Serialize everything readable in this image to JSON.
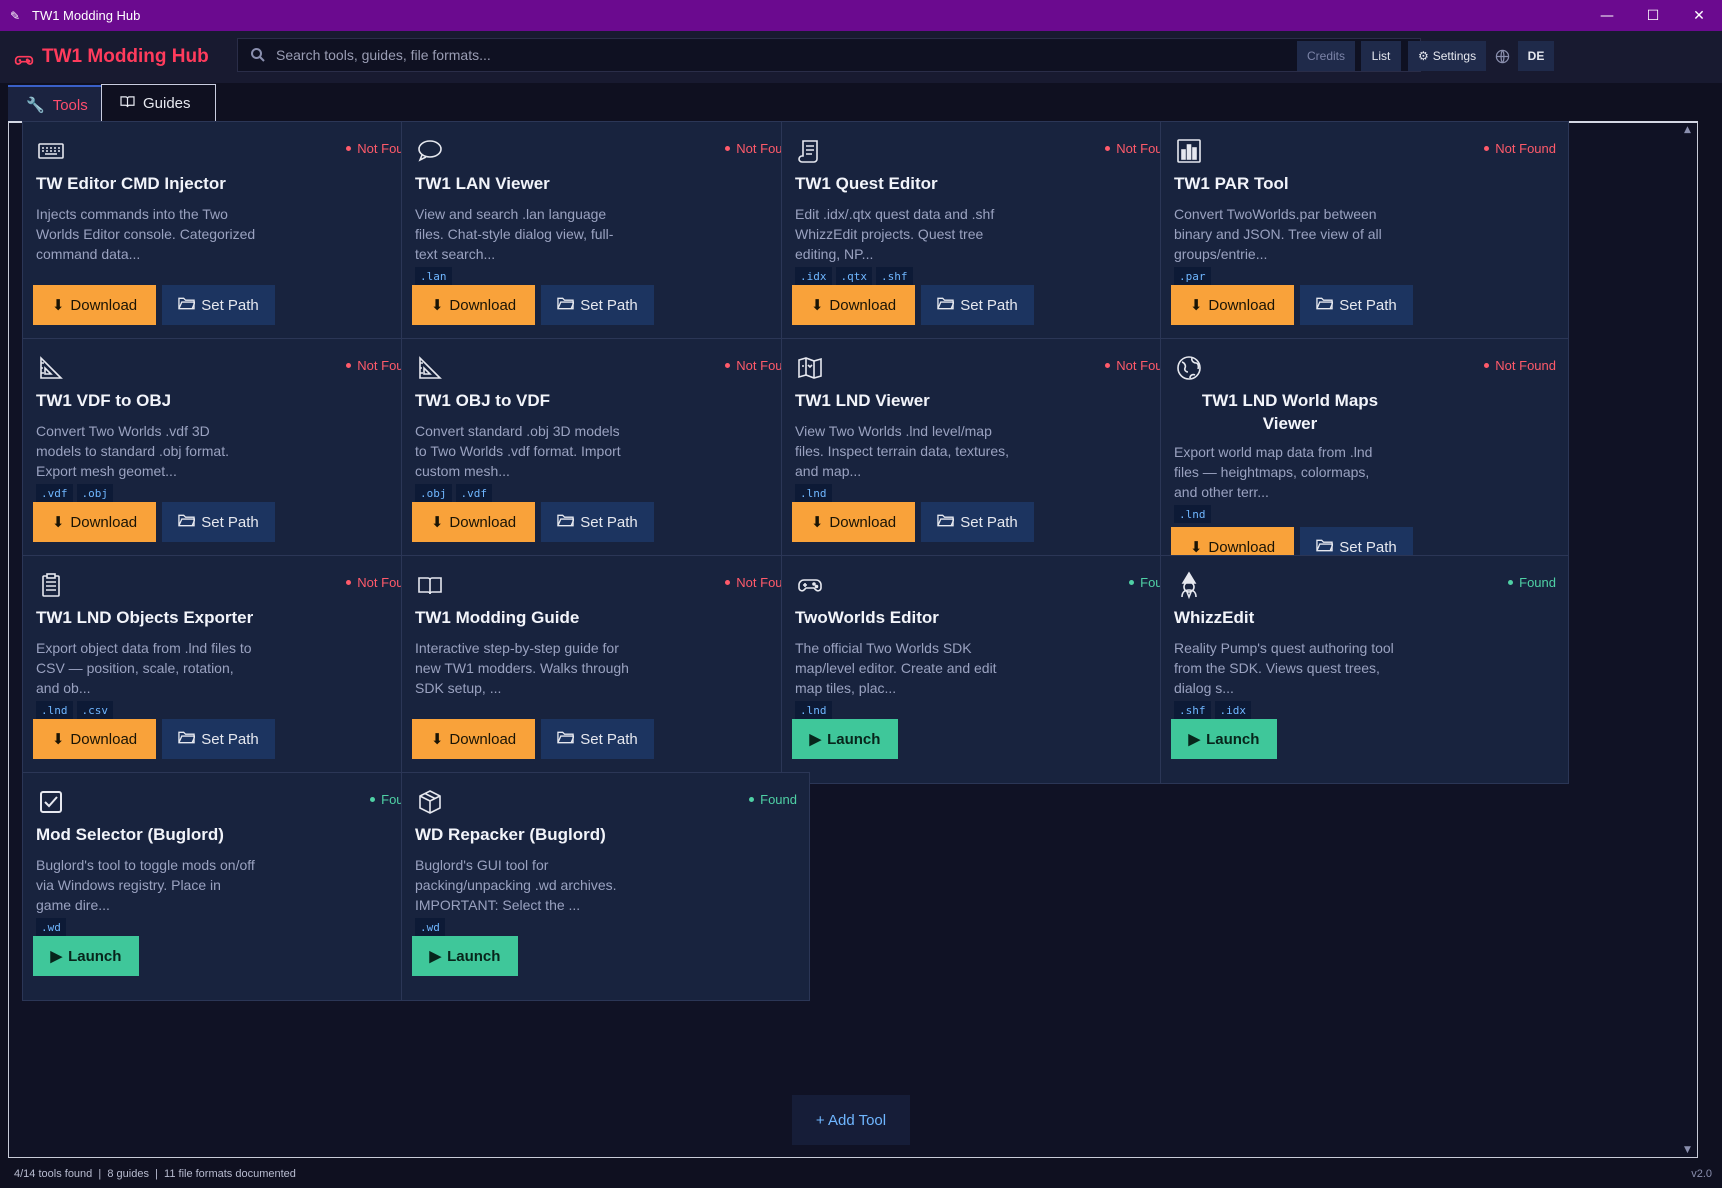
{
  "window": {
    "title": "TW1 Modding Hub",
    "controls": [
      "minimize",
      "maximize",
      "close"
    ]
  },
  "header": {
    "brand": "TW1 Modding Hub",
    "search_placeholder": "Search tools, guides, file formats...",
    "buttons": {
      "credits": "Credits",
      "list": "List",
      "settings": "Settings",
      "lang": "DE"
    }
  },
  "tabs": [
    {
      "label": "Tools",
      "active": true
    },
    {
      "label": "Guides",
      "active": false
    }
  ],
  "cards": [
    {
      "icon": "keyboard-icon",
      "title": "TW Editor CMD Injector",
      "status": "Not Found",
      "desc": "Injects commands into the Two Worlds Editor console. Categorized command data...",
      "tags": [],
      "actions": [
        "Download",
        "Set Path"
      ]
    },
    {
      "icon": "chat-icon",
      "title": "TW1 LAN Viewer",
      "status": "Not Found",
      "desc": "View and search .lan language files. Chat-style dialog view, full-text search...",
      "tags": [
        ".lan"
      ],
      "actions": [
        "Download",
        "Set Path"
      ]
    },
    {
      "icon": "scroll-icon",
      "title": "TW1 Quest Editor",
      "status": "Not Found",
      "desc": "Edit .idx/.qtx quest data and .shf WhizzEdit projects. Quest tree editing, NP...",
      "tags": [
        ".idx",
        ".qtx",
        ".shf"
      ],
      "actions": [
        "Download",
        "Set Path"
      ]
    },
    {
      "icon": "bar-chart-icon",
      "title": "TW1 PAR Tool",
      "status": "Not Found",
      "desc": "Convert TwoWorlds.par between binary and JSON. Tree view of all groups/entrie...",
      "tags": [
        ".par"
      ],
      "actions": [
        "Download",
        "Set Path"
      ]
    },
    {
      "icon": "triangle-ruler-icon",
      "title": "TW1 VDF to OBJ",
      "status": "Not Found",
      "desc": "Convert Two Worlds .vdf 3D models to standard .obj format. Export mesh geomet...",
      "tags": [
        ".vdf",
        ".obj"
      ],
      "actions": [
        "Download",
        "Set Path"
      ]
    },
    {
      "icon": "triangle-ruler-icon",
      "title": "TW1 OBJ to VDF",
      "status": "Not Found",
      "desc": "Convert standard .obj 3D models to Two Worlds .vdf format. Import custom mesh...",
      "tags": [
        ".obj",
        ".vdf"
      ],
      "actions": [
        "Download",
        "Set Path"
      ]
    },
    {
      "icon": "map-icon",
      "title": "TW1 LND Viewer",
      "status": "Not Found",
      "desc": "View Two Worlds .lnd level/map files. Inspect terrain data, textures, and map...",
      "tags": [
        ".lnd"
      ],
      "actions": [
        "Download",
        "Set Path"
      ]
    },
    {
      "icon": "globe-icon",
      "title": "TW1 LND World Maps Viewer",
      "status": "Not Found",
      "desc": "Export world map data from .lnd files — heightmaps, colormaps, and other terr...",
      "tags": [
        ".lnd"
      ],
      "actions": [
        "Download",
        "Set Path"
      ]
    },
    {
      "icon": "clipboard-icon",
      "title": "TW1 LND Objects Exporter",
      "status": "Not Found",
      "desc": "Export object data from .lnd files to CSV — position, scale, rotation, and ob...",
      "tags": [
        ".lnd",
        ".csv"
      ],
      "actions": [
        "Download",
        "Set Path"
      ]
    },
    {
      "icon": "book-icon",
      "title": "TW1 Modding Guide",
      "status": "Not Found",
      "desc": "Interactive step-by-step guide for new TW1 modders. Walks through SDK setup, ...",
      "tags": [],
      "actions": [
        "Download",
        "Set Path"
      ]
    },
    {
      "icon": "gamepad-icon",
      "title": "TwoWorlds Editor",
      "status": "Found",
      "desc": "The official Two Worlds SDK map/level editor. Create and edit map tiles, plac...",
      "tags": [
        ".lnd"
      ],
      "actions": [
        "Launch"
      ]
    },
    {
      "icon": "mage-icon",
      "title": "WhizzEdit",
      "status": "Found",
      "desc": "Reality Pump's quest authoring tool from the SDK. Views quest trees, dialog s...",
      "tags": [
        ".shf",
        ".idx"
      ],
      "actions": [
        "Launch"
      ]
    },
    {
      "icon": "checkbox-icon",
      "title": "Mod Selector (Buglord)",
      "status": "Found",
      "desc": "Buglord's tool to toggle mods on/off via Windows registry. Place in game dire...",
      "tags": [
        ".wd"
      ],
      "actions": [
        "Launch"
      ]
    },
    {
      "icon": "package-icon",
      "title": "WD Repacker (Buglord)",
      "status": "Found",
      "desc": "Buglord's GUI tool for packing/unpacking .wd archives. IMPORTANT: Select the ...",
      "tags": [
        ".wd"
      ],
      "actions": [
        "Launch"
      ]
    }
  ],
  "add_tool": "+ Add Tool",
  "statusbar": {
    "summary": "4/14 tools found  |  8 guides  |  11 file formats documented",
    "version": "v2.0"
  }
}
